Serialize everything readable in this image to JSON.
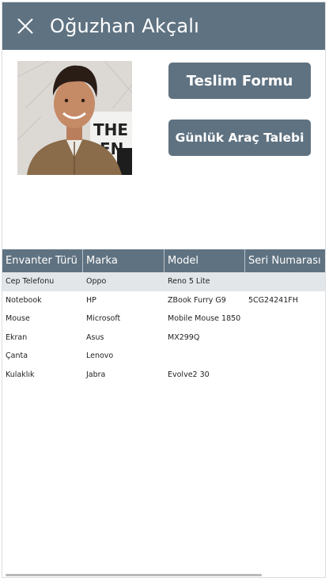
{
  "header": {
    "title": "Oğuzhan Akçalı",
    "close_icon": "close-icon"
  },
  "actions": {
    "delivery_form": "Teslim Formu",
    "daily_vehicle_request": "Günlük Araç Talebi"
  },
  "table": {
    "columns": [
      "Envanter Türü",
      "Marka",
      "Model",
      "Seri Numarası"
    ],
    "rows": [
      [
        "Cep Telefonu",
        "Oppo",
        "Reno 5 Lite",
        ""
      ],
      [
        "Notebook",
        "HP",
        "ZBook Furry G9",
        "5CG24241FH"
      ],
      [
        "Mouse",
        "Microsoft",
        "Mobile Mouse 1850",
        ""
      ],
      [
        "Ekran",
        "Asus",
        "MX299Q",
        ""
      ],
      [
        "Çanta",
        "Lenovo",
        "",
        ""
      ],
      [
        "Kulaklık",
        "Jabra",
        "Evolve2 30",
        ""
      ]
    ],
    "selected_row": 0
  },
  "colors": {
    "accent": "#5f7281",
    "selected_row": "#e3e6e9"
  }
}
